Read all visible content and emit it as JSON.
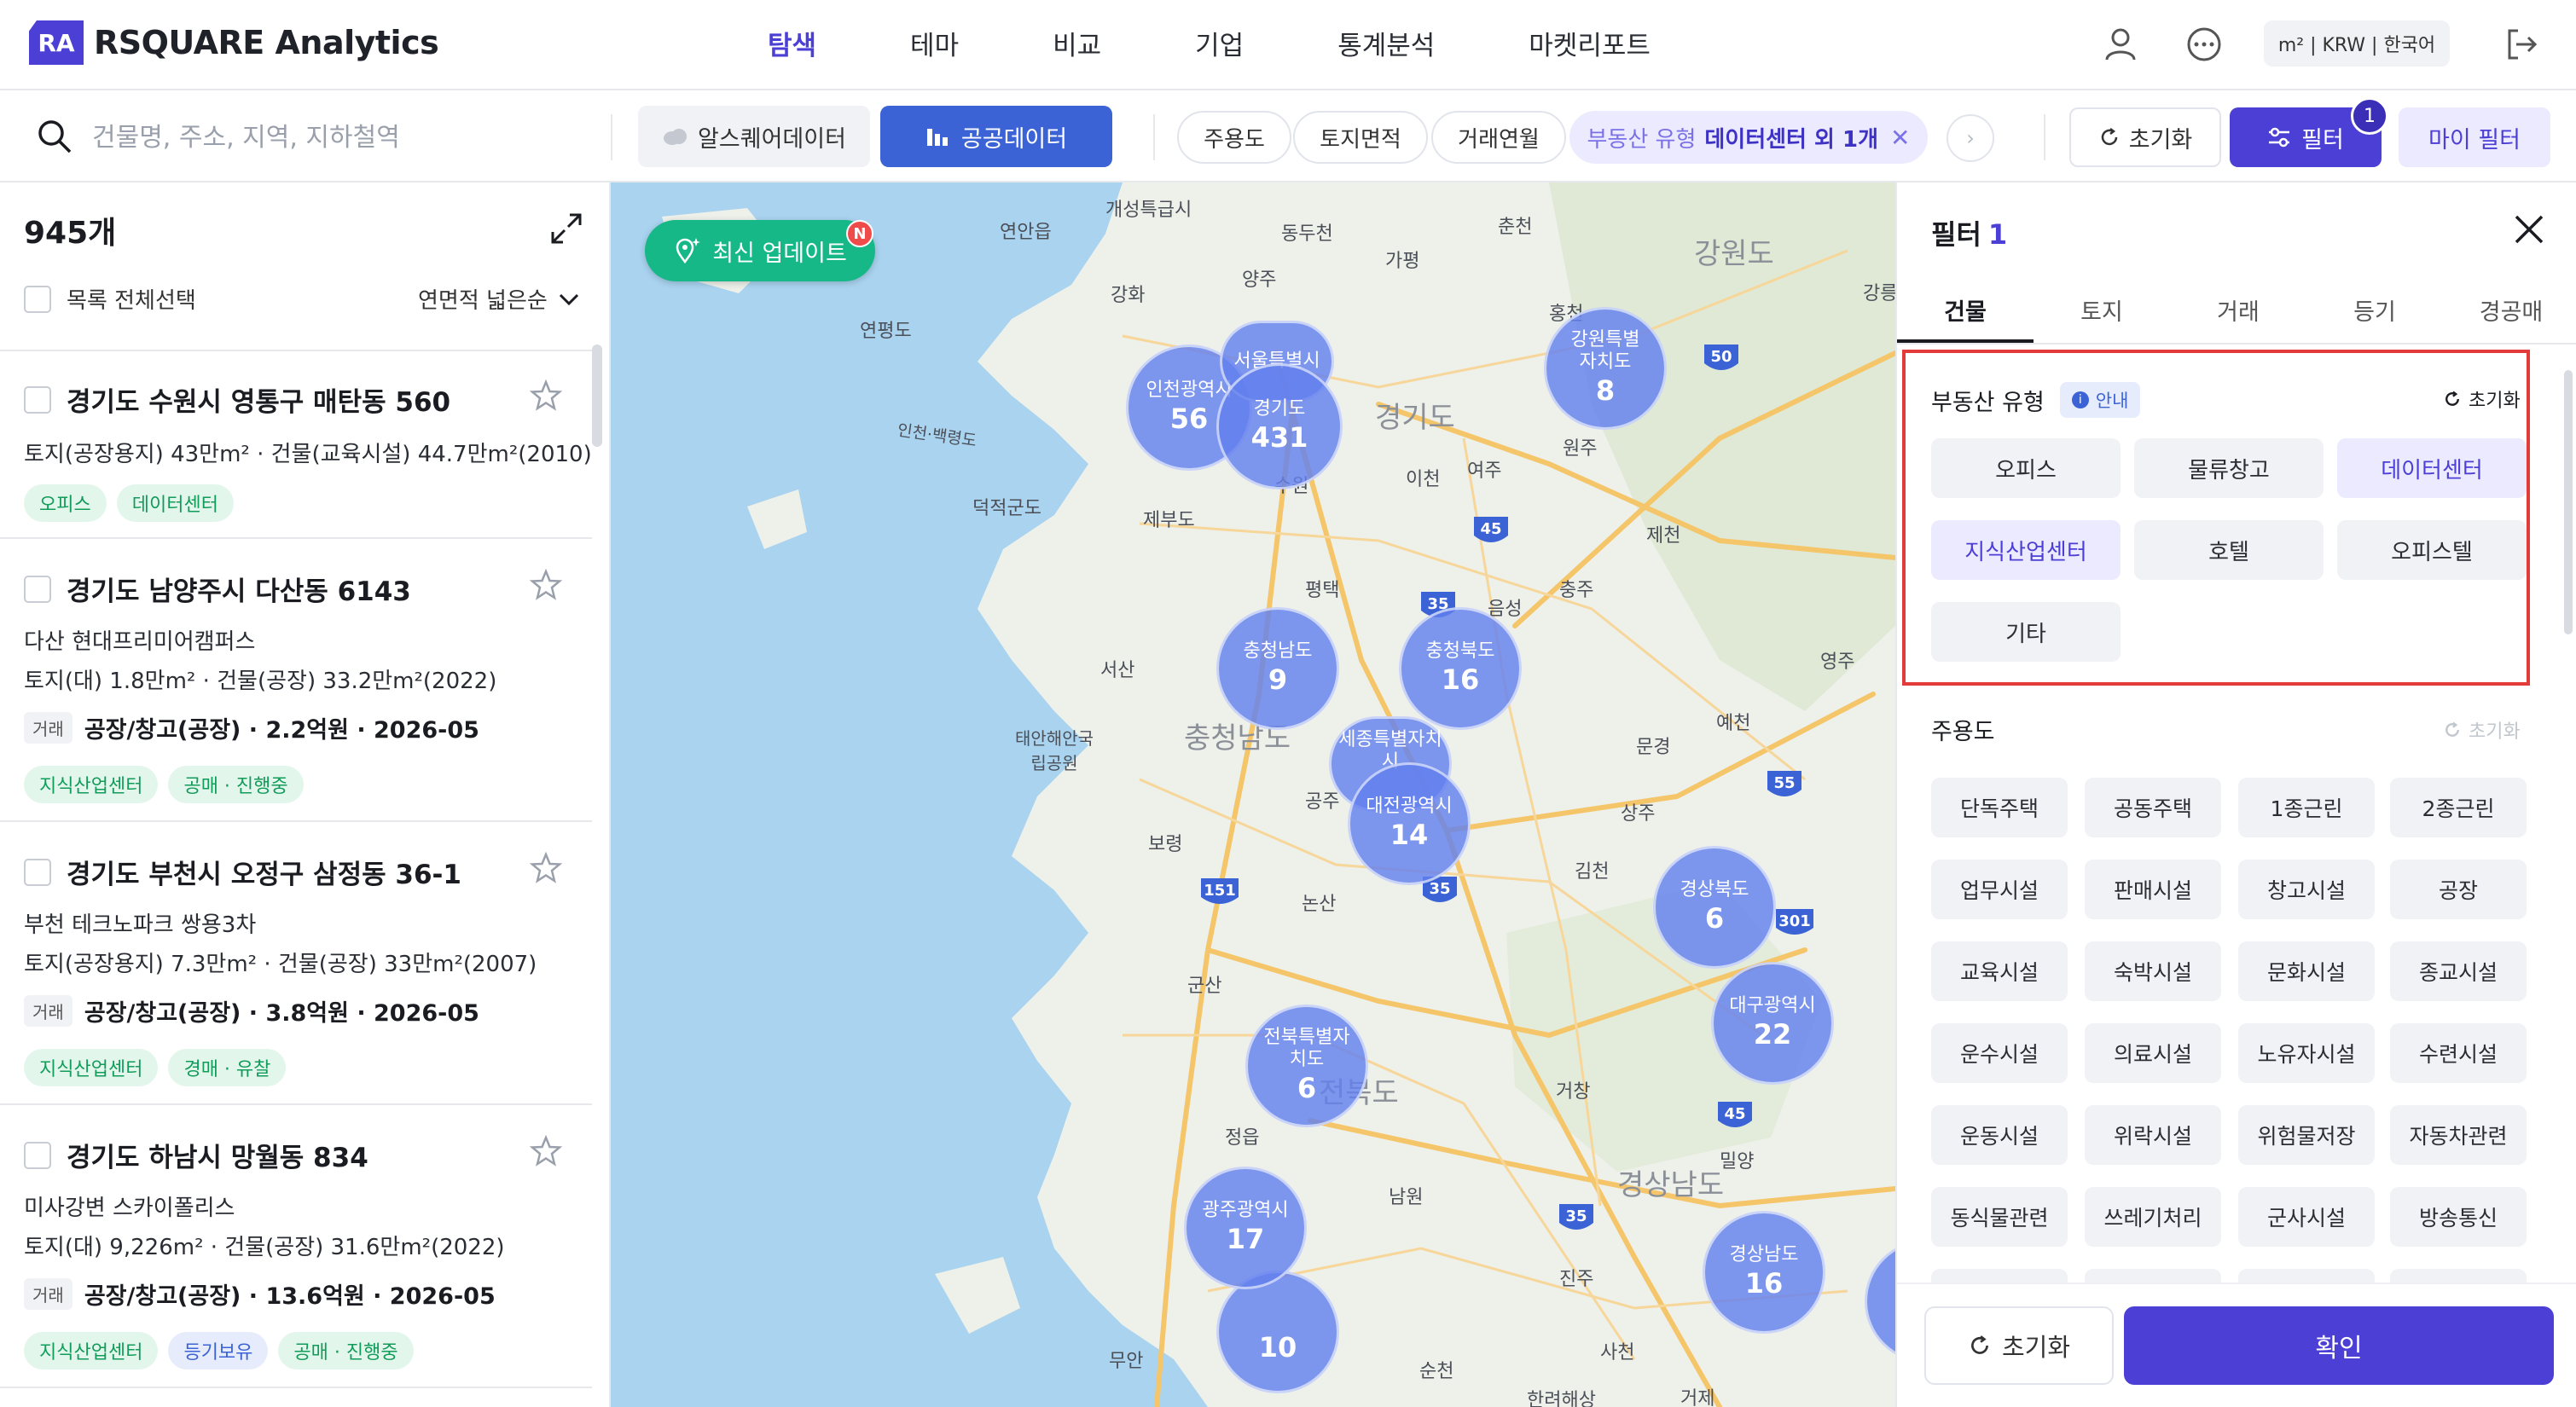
{
  "header": {
    "logo_mark": "RA",
    "logo_text": "RSQUARE Analytics",
    "nav": [
      "탐색",
      "테마",
      "비교",
      "기업",
      "통계분석",
      "마켓리포트"
    ],
    "active_nav": "탐색",
    "unit_label": "m² | KRW | 한국어",
    "icons": [
      "user-icon",
      "more-icon",
      "logout-icon"
    ]
  },
  "searchbar": {
    "placeholder": "건물명, 주소, 지역, 지하철역",
    "source_alt": "알스퀘어데이터",
    "source_public": "공공데이터",
    "chips": [
      "주용도",
      "토지면적",
      "거래연월"
    ],
    "active_chip_label": "부동산 유형",
    "active_chip_value": "데이터센터 외 1개",
    "reset": "초기화",
    "filter": "필터",
    "filter_badge": "1",
    "my_filter": "마이 필터"
  },
  "list": {
    "count": "945개",
    "select_all": "목록 전체선택",
    "sort": "연면적 넓은순",
    "items": [
      {
        "title": "경기도 수원시 영통구 매탄동 560",
        "subtitle": "",
        "spec": "토지(공장용지) 43만m² · 건물(교육시설) 44.7만m²(2010)",
        "deal_tag": "",
        "deal": "",
        "tags": [
          {
            "text": "오피스",
            "color": "green"
          },
          {
            "text": "데이터센터",
            "color": "green"
          }
        ]
      },
      {
        "title": "경기도 남양주시 다산동 6143",
        "subtitle": "다산 현대프리미어캠퍼스",
        "spec": "토지(대) 1.8만m² · 건물(공장) 33.2만m²(2022)",
        "deal_tag": "거래",
        "deal": "공장/창고(공장) · 2.2억원 · 2026-05",
        "tags": [
          {
            "text": "지식산업센터",
            "color": "green"
          },
          {
            "text": "공매 · 진행중",
            "color": "green"
          }
        ]
      },
      {
        "title": "경기도 부천시 오정구 삼정동 36-1",
        "subtitle": "부천 테크노파크 쌍용3차",
        "spec": "토지(공장용지) 7.3만m² · 건물(공장) 33만m²(2007)",
        "deal_tag": "거래",
        "deal": "공장/창고(공장) · 3.8억원 · 2026-05",
        "tags": [
          {
            "text": "지식산업센터",
            "color": "green"
          },
          {
            "text": "경매 · 유찰",
            "color": "green"
          }
        ]
      },
      {
        "title": "경기도 하남시 망월동 834",
        "subtitle": "미사강변 스카이폴리스",
        "spec": "토지(대) 9,226m² · 건물(공장) 31.6만m²(2022)",
        "deal_tag": "거래",
        "deal": "공장/창고(공장) · 13.6억원 · 2026-05",
        "tags": [
          {
            "text": "지식산업센터",
            "color": "green"
          },
          {
            "text": "등기보유",
            "color": "blue"
          },
          {
            "text": "공매 · 진행중",
            "color": "green"
          }
        ]
      }
    ]
  },
  "map": {
    "update_button": "최신 업데이트",
    "update_badge": "N",
    "clusters": [
      {
        "name": "인천광역시",
        "count": "56"
      },
      {
        "name": "서울특별시",
        "count": ""
      },
      {
        "name": "경기도",
        "count": "431"
      },
      {
        "name": "강원특별자치도",
        "count": "8"
      },
      {
        "name": "충청남도",
        "count": "9"
      },
      {
        "name": "충청북도",
        "count": "16"
      },
      {
        "name": "세종특별자치시",
        "count": ""
      },
      {
        "name": "대전광역시",
        "count": "14"
      },
      {
        "name": "경상북도",
        "count": "6"
      },
      {
        "name": "전북특별자치도",
        "count": "6"
      },
      {
        "name": "대구광역시",
        "count": "22"
      },
      {
        "name": "광주광역시",
        "count": "17"
      },
      {
        "name": "경상남도",
        "count": "16"
      },
      {
        "name": "",
        "count": "10"
      }
    ],
    "regions": [
      "강원도",
      "경기도",
      "충청남도",
      "전북도",
      "경상남도"
    ],
    "places": [
      "개성특급시",
      "연안읍",
      "동두천",
      "춘천",
      "양주",
      "가평",
      "강화",
      "연평도",
      "홍천",
      "원주",
      "이천",
      "여주",
      "제부도",
      "덕적군도",
      "수원",
      "평택",
      "충주",
      "제천",
      "음성",
      "서산",
      "영주",
      "태안해안국립공원",
      "예천",
      "문경",
      "공주",
      "보령",
      "상주",
      "논산",
      "김천",
      "군산",
      "거창",
      "정읍",
      "남원",
      "밀양",
      "진주",
      "사천",
      "순천",
      "무안",
      "거제",
      "한려해상",
      "강릉",
      "인천·백령도"
    ],
    "highway_shields": [
      "50",
      "45",
      "35",
      "55",
      "151",
      "35",
      "301",
      "45",
      "35"
    ]
  },
  "filter_panel": {
    "title": "필터",
    "count": "1",
    "tabs": [
      "건물",
      "토지",
      "거래",
      "등기",
      "경공매"
    ],
    "active_tab": "건물",
    "property_type": {
      "label": "부동산 유형",
      "info": "안내",
      "reset": "초기화",
      "options": [
        "오피스",
        "물류창고",
        "데이터센터",
        "지식산업센터",
        "호텔",
        "오피스텔",
        "기타"
      ],
      "selected": [
        "데이터센터",
        "지식산업센터"
      ]
    },
    "main_use": {
      "label": "주용도",
      "reset": "초기화",
      "options": [
        "단독주택",
        "공동주택",
        "1종근린",
        "2종근린",
        "업무시설",
        "판매시설",
        "창고시설",
        "공장",
        "교육시설",
        "숙박시설",
        "문화시설",
        "종교시설",
        "운수시설",
        "의료시설",
        "노유자시설",
        "수련시설",
        "운동시설",
        "위락시설",
        "위험물저장",
        "자동차관련",
        "동식물관련",
        "쓰레기처리",
        "군사시설",
        "방송통신"
      ]
    },
    "footer_reset": "초기화",
    "footer_confirm": "확인"
  },
  "colors": {
    "primary": "#4b3fd6",
    "public_data": "#3b63d6",
    "update_green": "#17b888",
    "cluster": "#6380ee",
    "highlight": "#e33a3a",
    "tag_green": "#119c5a"
  }
}
